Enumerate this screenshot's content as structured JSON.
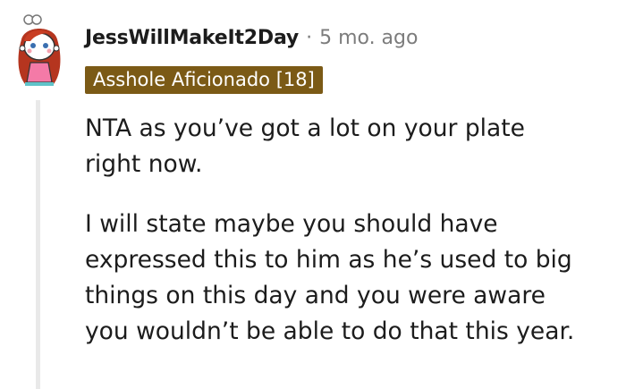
{
  "comment": {
    "username": "JessWillMakeIt2Day",
    "separator": "·",
    "timestamp": "5 mo. ago",
    "flair": "Asshole Aficionado [18]",
    "paragraphs": [
      {
        "lines": [
          "NTA as you’ve got a lot on your plate",
          "right now."
        ]
      },
      {
        "lines": [
          "I will state maybe you should have",
          "expressed this to him as he’s used to big",
          "things on this day and you were aware",
          "you wouldn’t be able to do that this year."
        ]
      }
    ]
  },
  "colors": {
    "flair_background": "#7b5a16",
    "flair_text": "#ffffff",
    "meta_text": "#7c7c7c",
    "thread_line": "#e9e9e9"
  },
  "icons": {
    "avatar": "snoo-avatar-icon"
  }
}
